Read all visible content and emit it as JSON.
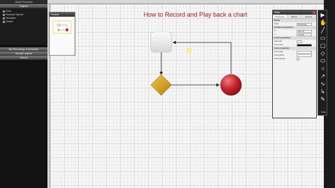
{
  "app": {
    "title": "Quick Flowchart"
  },
  "left_panel": {
    "objects_header": "Objects",
    "tree": [
      {
        "label": "Chart"
      },
      {
        "label": "Flowchart Symbol"
      },
      {
        "label": "Templates"
      },
      {
        "label": "Custom"
      }
    ],
    "sections": [
      {
        "label": "My Recordings & Animation"
      },
      {
        "label": "Sample objects"
      },
      {
        "label": "Search"
      }
    ]
  },
  "preview": {
    "title": "Preview"
  },
  "chart": {
    "title": "How to Record and Play back a chart"
  },
  "editor": {
    "title": "Editor",
    "close": "x",
    "tabs": [
      {
        "label": "Properties"
      },
      {
        "label": "Values"
      },
      {
        "label": "Options"
      }
    ],
    "rows": [
      {
        "label": "Name",
        "value": "",
        "section": true
      },
      {
        "label": "Kind",
        "value": "Rectangle",
        "section": false
      },
      {
        "label": "Position properties",
        "value": "",
        "section": true
      },
      {
        "label": "X",
        "value": "192.10",
        "section": false
      },
      {
        "label": "Y",
        "value": "175.30",
        "section": false
      },
      {
        "label": "Color properties",
        "value": "",
        "section": true
      },
      {
        "label": "Fill color",
        "value": "",
        "section": false
      },
      {
        "label": "Line color",
        "value": "",
        "section": false
      },
      {
        "label": "Line properties",
        "value": "",
        "section": true
      },
      {
        "label": "Line style",
        "value": "",
        "section": false
      },
      {
        "label": "Line width",
        "value": "",
        "section": false
      },
      {
        "label": "Auto Resize",
        "value": "",
        "section": false
      }
    ]
  },
  "toolbar": {
    "tools": [
      {
        "icon": "pointer-icon"
      },
      {
        "icon": "hand-icon"
      },
      {
        "icon": "line-icon"
      },
      {
        "icon": "rectangle-icon"
      },
      {
        "icon": "rounded-rectangle-icon"
      },
      {
        "icon": "diamond-icon"
      },
      {
        "icon": "ellipse-icon"
      },
      {
        "icon": "circle-icon"
      },
      {
        "icon": "arrow-icon"
      },
      {
        "icon": "curve-icon"
      },
      {
        "icon": "connector-icon"
      },
      {
        "icon": "pencil-icon"
      }
    ],
    "label": "TIME"
  },
  "colors": {
    "title": "#9b1a1a",
    "diamond": "#d9a21a",
    "circle": "#c0202a",
    "rect": "#e8eaec"
  }
}
